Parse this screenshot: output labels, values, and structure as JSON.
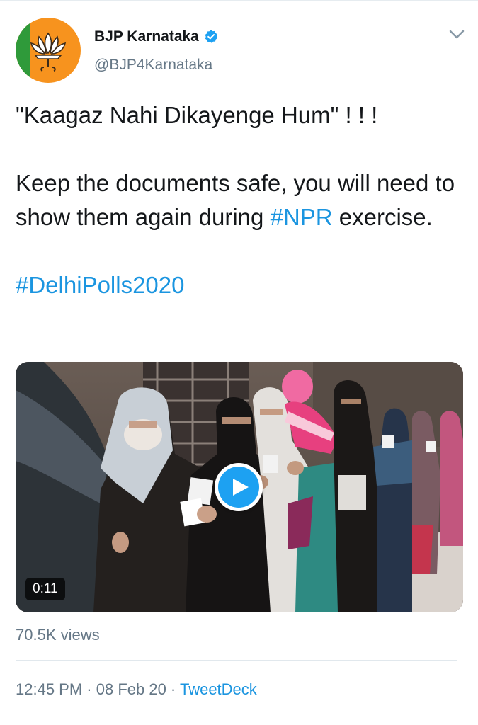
{
  "tweet": {
    "author": {
      "display_name": "BJP Karnataka",
      "handle": "@BJP4Karnataka",
      "verified": true,
      "avatar_icon": "lotus-logo-icon"
    },
    "menu_icon": "chevron-down-icon",
    "text": {
      "line1": "\"Kaagaz Nahi Dikayenge Hum\" ! ! !",
      "body_before_hashtag": "Keep the documents safe, you will need to show them again during ",
      "hashtag_npr": "#NPR",
      "body_after_hashtag": " exercise.",
      "hashtag_delhi": "#DelhiPolls2020"
    },
    "media": {
      "type": "video",
      "play_icon": "play-icon",
      "duration": "0:11"
    },
    "views": "70.5K views",
    "meta": {
      "time": "12:45 PM",
      "separator": " · ",
      "date": "08 Feb 20",
      "source": "TweetDeck"
    }
  },
  "colors": {
    "link": "#1b95e0",
    "secondary_text": "#657786",
    "primary_text": "#14171a",
    "play_button": "#1da1f2",
    "avatar_orange": "#f7931e",
    "avatar_green": "#2f9a3a"
  }
}
